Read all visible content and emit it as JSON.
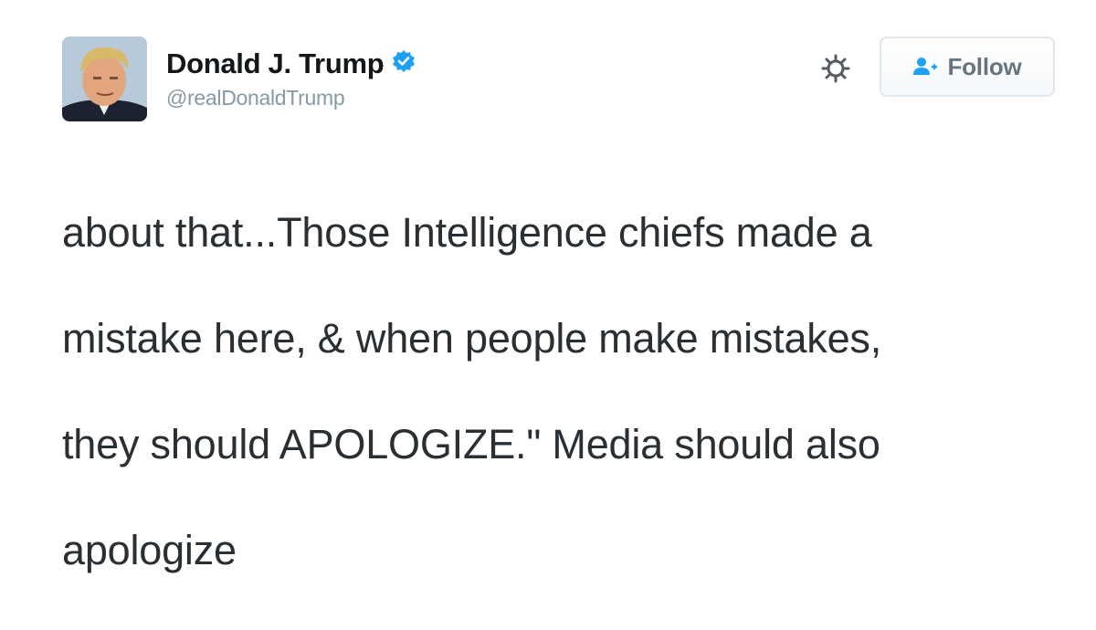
{
  "tweet": {
    "author": {
      "display_name": "Donald J. Trump",
      "handle": "@realDonaldTrump",
      "verified": true,
      "avatar_icon": "profile-photo"
    },
    "actions": {
      "settings_icon": "gear-icon",
      "follow_label": "Follow",
      "follow_icon": "add-user-icon"
    },
    "text_lines": [
      "about that...Those Intelligence chiefs made a",
      "mistake here, & when people make mistakes,",
      "they should APOLOGIZE.\" Media should also",
      "apologize"
    ]
  },
  "colors": {
    "verified_blue": "#1da1f2",
    "text": "#292f33",
    "handle_gray": "#8899a6",
    "button_border": "#e1e8ed",
    "follow_text": "#66757f"
  }
}
